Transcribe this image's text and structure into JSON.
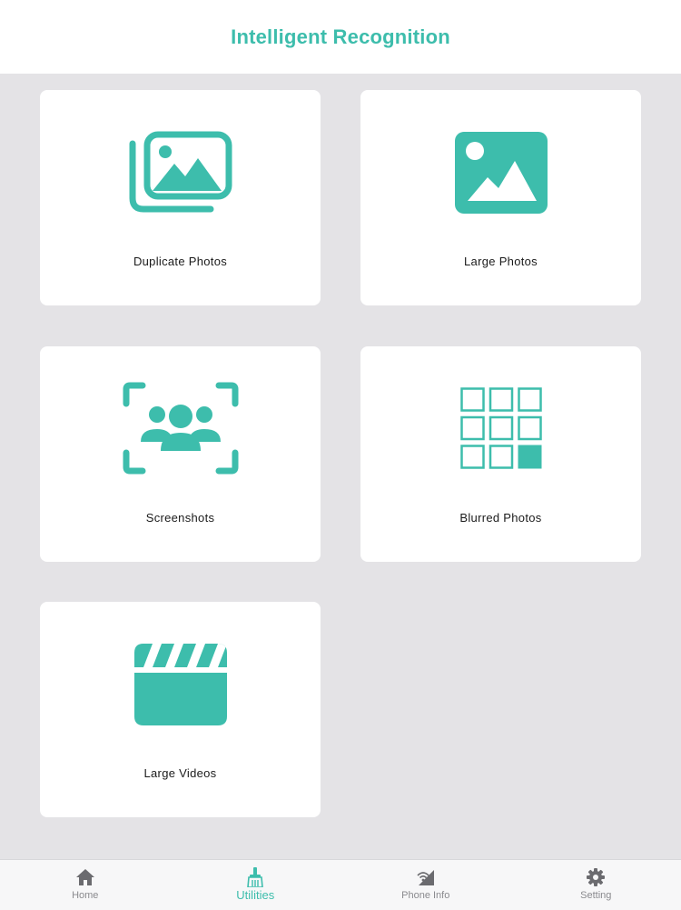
{
  "header": {
    "title": "Intelligent Recognition"
  },
  "cards": [
    {
      "label": "Duplicate Photos",
      "icon": "duplicate-photos-icon"
    },
    {
      "label": "Large Photos",
      "icon": "large-photo-icon"
    },
    {
      "label": "Screenshots",
      "icon": "face-scan-icon"
    },
    {
      "label": "Blurred Photos",
      "icon": "grid-icon"
    },
    {
      "label": "Large Videos",
      "icon": "clapperboard-icon"
    }
  ],
  "tabbar": {
    "tabs": [
      {
        "label": "Home",
        "icon": "home-icon",
        "active": false
      },
      {
        "label": "Utilities",
        "icon": "broom-icon",
        "active": true
      },
      {
        "label": "Phone Info",
        "icon": "signal-icon",
        "active": false
      },
      {
        "label": "Setting",
        "icon": "gear-icon",
        "active": false
      }
    ]
  },
  "colors": {
    "accent": "#3dbdac",
    "background": "#e4e3e6",
    "card": "#ffffff",
    "inactive_tab": "#8a8a8e"
  }
}
